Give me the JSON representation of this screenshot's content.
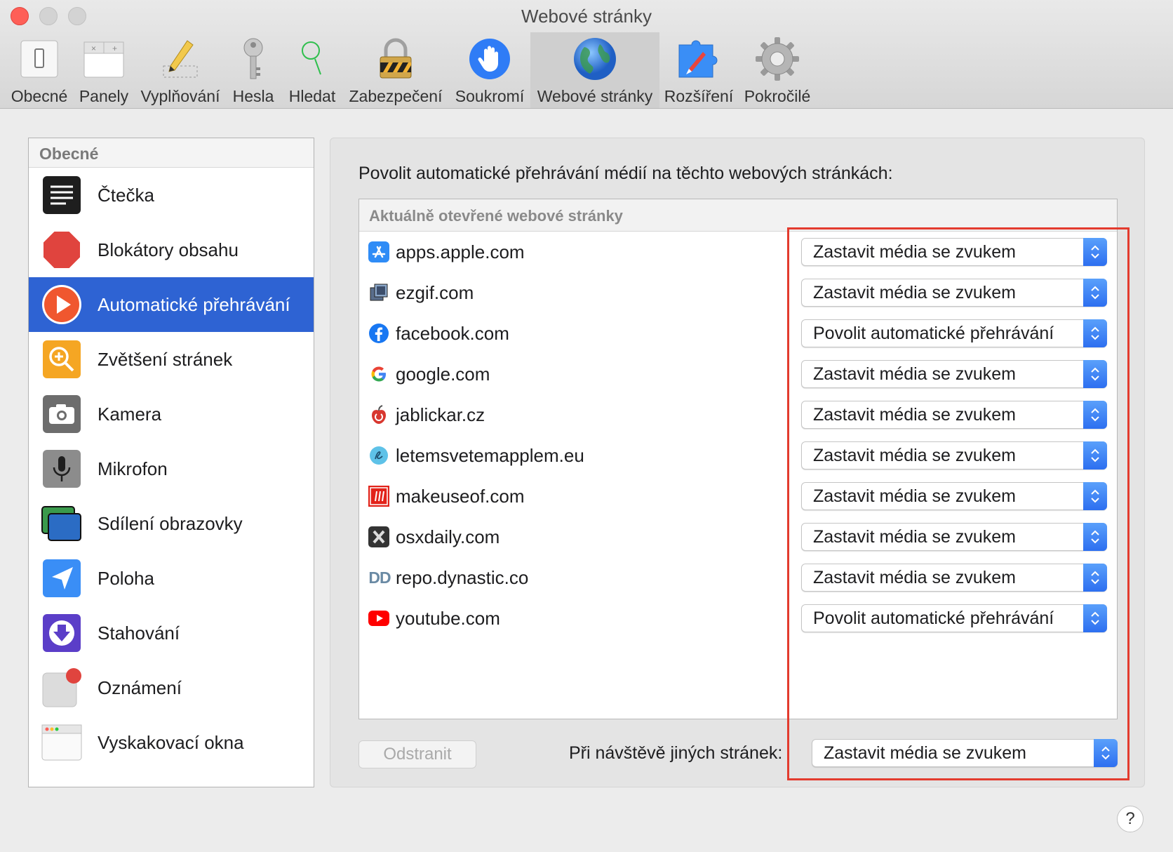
{
  "window": {
    "title": "Webové stránky"
  },
  "toolbar": {
    "items": [
      {
        "label": "Obecné",
        "icon": "general-switch-icon"
      },
      {
        "label": "Panely",
        "icon": "tabs-icon"
      },
      {
        "label": "Vyplňování",
        "icon": "pencil-icon"
      },
      {
        "label": "Hesla",
        "icon": "key-icon"
      },
      {
        "label": "Hledat",
        "icon": "magnifier-icon"
      },
      {
        "label": "Zabezpečení",
        "icon": "lock-icon"
      },
      {
        "label": "Soukromí",
        "icon": "hand-icon"
      },
      {
        "label": "Webové stránky",
        "icon": "globe-icon",
        "selected": true
      },
      {
        "label": "Rozšíření",
        "icon": "puzzle-icon"
      },
      {
        "label": "Pokročilé",
        "icon": "gear-icon"
      }
    ]
  },
  "sidebar": {
    "header": "Obecné",
    "items": [
      {
        "label": "Čtečka",
        "icon": "reader-icon"
      },
      {
        "label": "Blokátory obsahu",
        "icon": "stop-sign-icon"
      },
      {
        "label": "Automatické přehrávání",
        "icon": "play-icon",
        "selected": true
      },
      {
        "label": "Zvětšení stránek",
        "icon": "zoom-icon"
      },
      {
        "label": "Kamera",
        "icon": "camera-icon"
      },
      {
        "label": "Mikrofon",
        "icon": "microphone-icon"
      },
      {
        "label": "Sdílení obrazovky",
        "icon": "screen-sharing-icon"
      },
      {
        "label": "Poloha",
        "icon": "location-icon"
      },
      {
        "label": "Stahování",
        "icon": "download-icon"
      },
      {
        "label": "Oznámení",
        "icon": "notification-icon"
      },
      {
        "label": "Vyskakovací okna",
        "icon": "popup-window-icon"
      }
    ]
  },
  "main": {
    "title": "Povolit automatické přehrávání médií na těchto webových stránkách:",
    "list_header": "Aktuálně otevřené webové stránky",
    "sites": [
      {
        "name": "apps.apple.com",
        "setting": "Zastavit média se zvukem",
        "icon": "app-store-icon"
      },
      {
        "name": "ezgif.com",
        "setting": "Zastavit média se zvukem",
        "icon": "ezgif-icon"
      },
      {
        "name": "facebook.com",
        "setting": "Povolit automatické přehrávání",
        "icon": "facebook-icon"
      },
      {
        "name": "google.com",
        "setting": "Zastavit média se zvukem",
        "icon": "google-icon"
      },
      {
        "name": "jablickar.cz",
        "setting": "Zastavit média se zvukem",
        "icon": "jablickar-icon"
      },
      {
        "name": "letemsvetemapplem.eu",
        "setting": "Zastavit média se zvukem",
        "icon": "letemsvetemapplem-icon"
      },
      {
        "name": "makeuseof.com",
        "setting": "Zastavit média se zvukem",
        "icon": "makeuseof-icon"
      },
      {
        "name": "osxdaily.com",
        "setting": "Zastavit média se zvukem",
        "icon": "osxdaily-icon"
      },
      {
        "name": "repo.dynastic.co",
        "setting": "Zastavit média se zvukem",
        "icon": "dynastic-icon",
        "icon_text": "DD"
      },
      {
        "name": "youtube.com",
        "setting": "Povolit automatické přehrávání",
        "icon": "youtube-icon"
      }
    ],
    "remove_label": "Odstranit",
    "other_sites_label": "Při návštěvě jiných stránek:",
    "other_sites_setting": "Zastavit média se zvukem",
    "help_label": "?"
  },
  "colors": {
    "selection": "#2e63d3",
    "highlight": "#e33b2e",
    "stepper": "#2d6ff0"
  }
}
